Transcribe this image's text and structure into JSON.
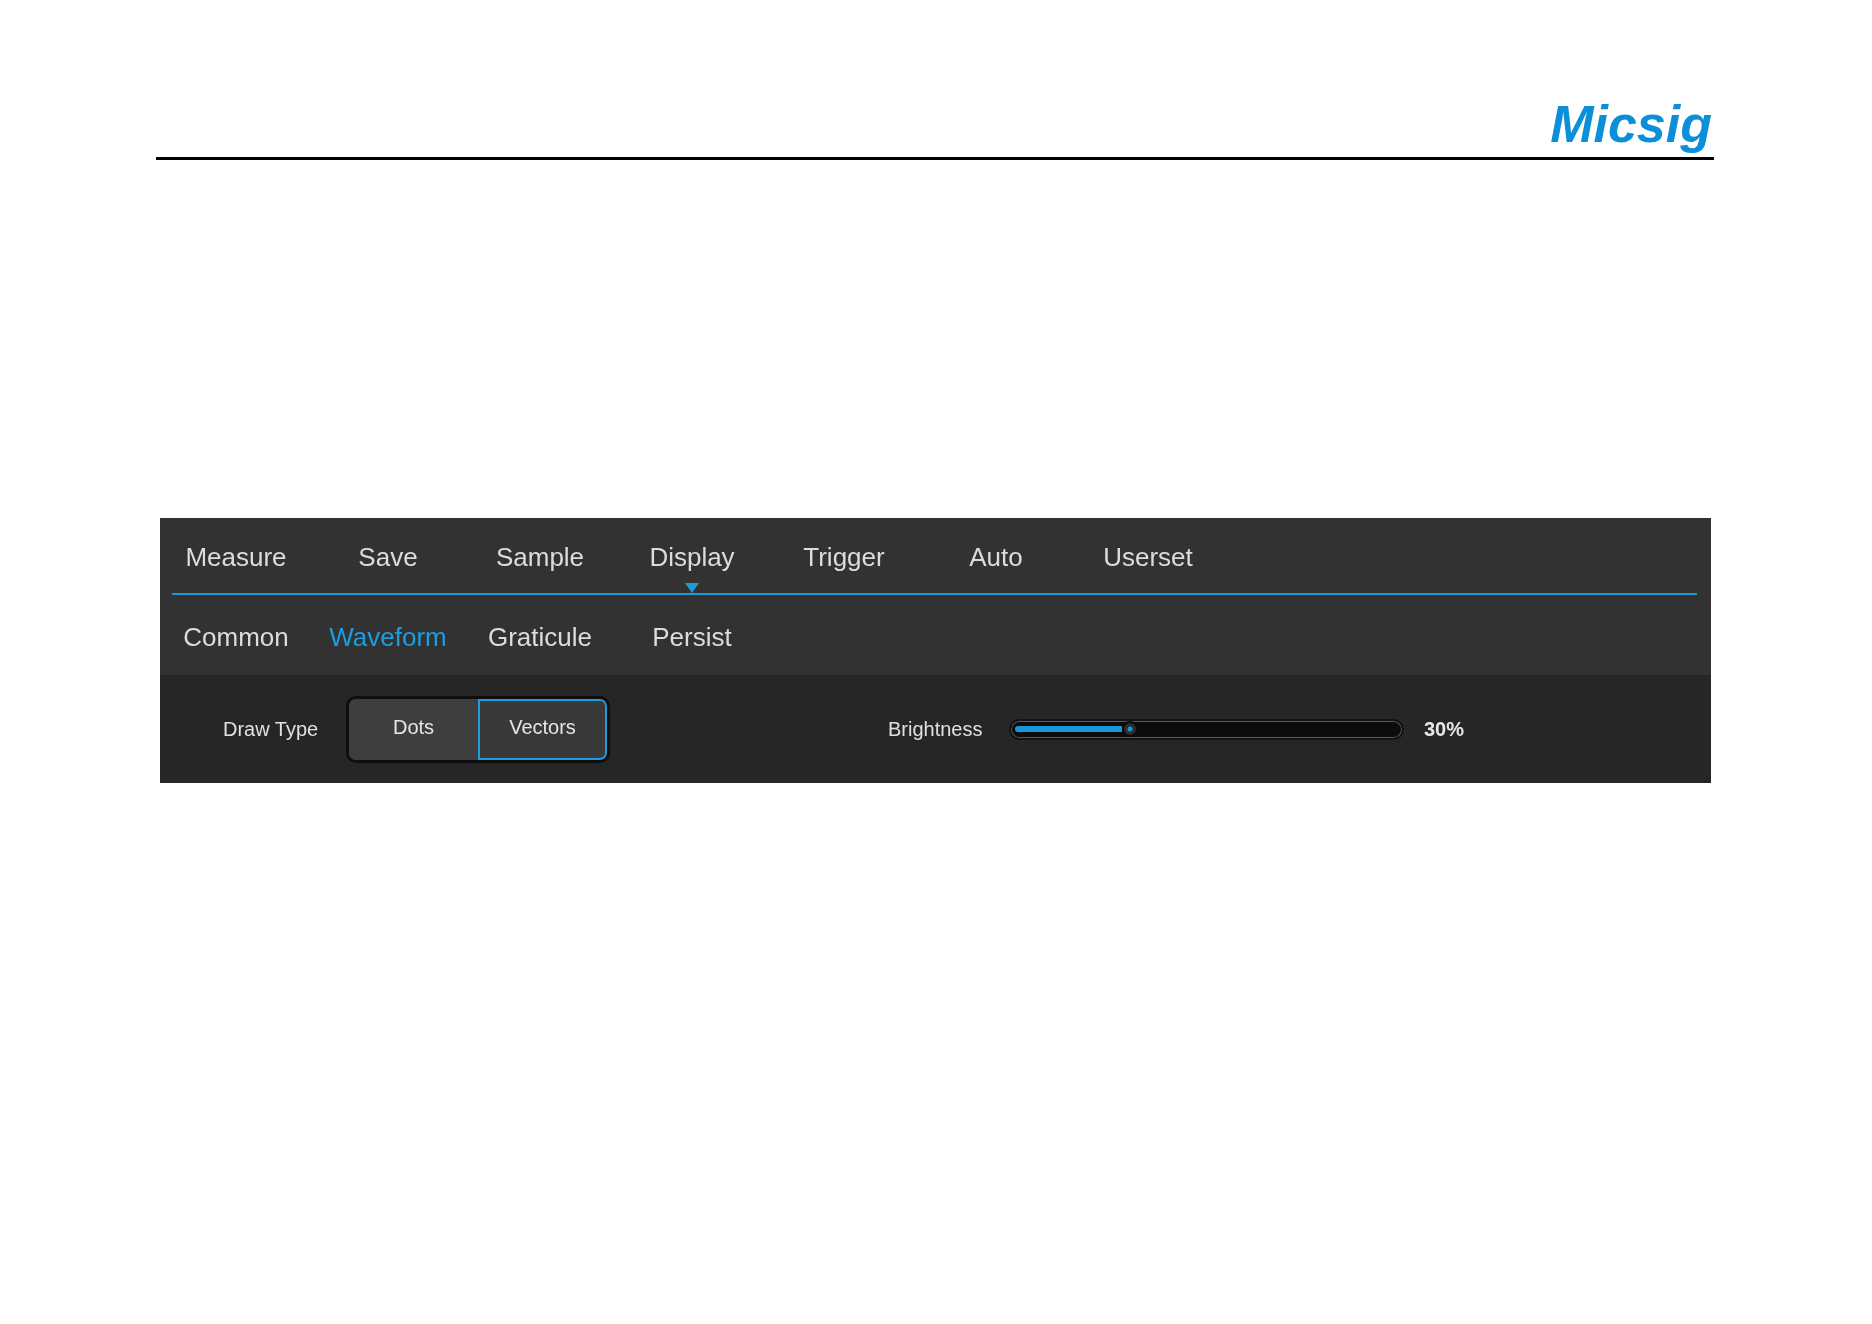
{
  "logo": {
    "text": "Micsig"
  },
  "menu": {
    "tabs": [
      {
        "label": "Measure",
        "selected": false
      },
      {
        "label": "Save",
        "selected": false
      },
      {
        "label": "Sample",
        "selected": false
      },
      {
        "label": "Display",
        "selected": true
      },
      {
        "label": "Trigger",
        "selected": false
      },
      {
        "label": "Auto",
        "selected": false
      },
      {
        "label": "Userset",
        "selected": false
      }
    ],
    "sub_tabs": [
      {
        "label": "Common",
        "selected": false
      },
      {
        "label": "Waveform",
        "selected": true
      },
      {
        "label": "Graticule",
        "selected": false
      },
      {
        "label": "Persist",
        "selected": false
      }
    ]
  },
  "settings": {
    "draw_type": {
      "label": "Draw Type",
      "options": [
        {
          "label": "Dots",
          "selected": false
        },
        {
          "label": "Vectors",
          "selected": true
        }
      ]
    },
    "brightness": {
      "label": "Brightness",
      "level": 0.3,
      "reading": "30%"
    }
  }
}
